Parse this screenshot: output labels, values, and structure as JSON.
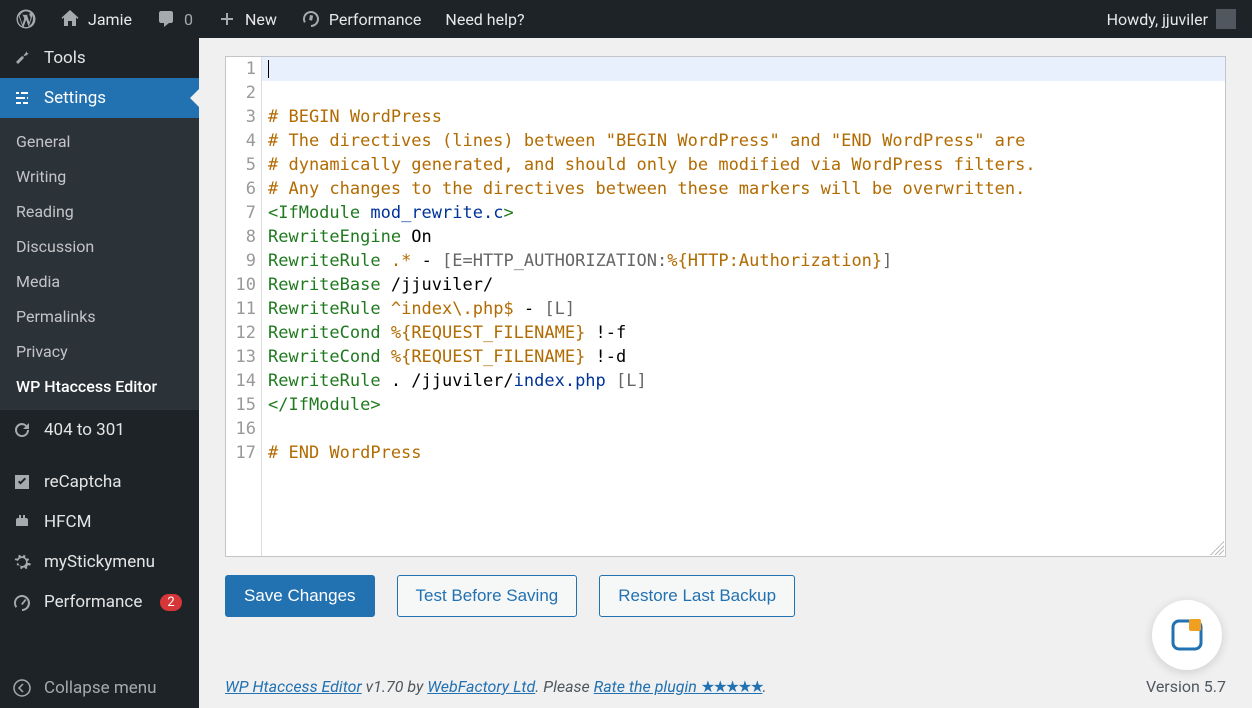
{
  "adminbar": {
    "site": "Jamie",
    "comments": "0",
    "new": "New",
    "perf": "Performance",
    "help": "Need help?",
    "howdy": "Howdy, jjuviler"
  },
  "sidebar": {
    "tools": "Tools",
    "settings": "Settings",
    "sub": [
      "General",
      "Writing",
      "Reading",
      "Discussion",
      "Media",
      "Permalinks",
      "Privacy",
      "WP Htaccess Editor"
    ],
    "redir": "404 to 301",
    "recaptcha": "reCaptcha",
    "hfcm": "HFCM",
    "sticky": "myStickymenu",
    "perf": "Performance",
    "perf_badge": "2",
    "collapse": "Collapse menu"
  },
  "code": {
    "lines": [
      "",
      "",
      "# BEGIN WordPress",
      "# The directives (lines) between \"BEGIN WordPress\" and \"END WordPress\" are",
      "# dynamically generated, and should only be modified via WordPress filters.",
      "# Any changes to the directives between these markers will be overwritten.",
      "<IfModule mod_rewrite.c>",
      "RewriteEngine On",
      "RewriteRule .* - [E=HTTP_AUTHORIZATION:%{HTTP:Authorization}]",
      "RewriteBase /jjuviler/",
      "RewriteRule ^index\\.php$ - [L]",
      "RewriteCond %{REQUEST_FILENAME} !-f",
      "RewriteCond %{REQUEST_FILENAME} !-d",
      "RewriteRule . /jjuviler/index.php [L]",
      "</IfModule>",
      "",
      "# END WordPress"
    ]
  },
  "buttons": {
    "save": "Save Changes",
    "test": "Test Before Saving",
    "restore": "Restore Last Backup"
  },
  "footer": {
    "plugin": "WP Htaccess Editor",
    "version_txt": " v1.70 by ",
    "vendor": "WebFactory Ltd",
    "please": ". Please ",
    "rate": "Rate the plugin ",
    "stars": "★★★★★",
    "dot": ".",
    "wp_version": "Version 5.7"
  }
}
